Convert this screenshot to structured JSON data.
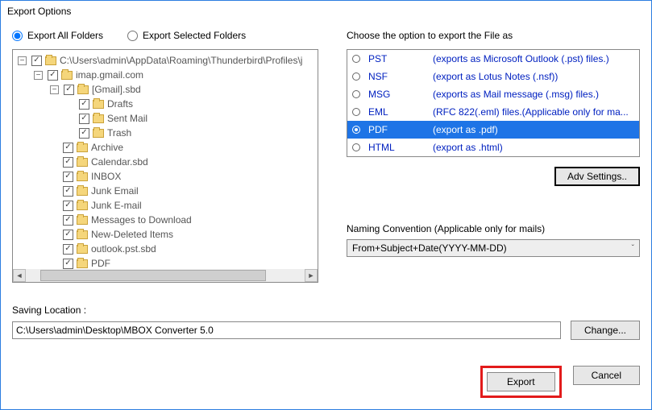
{
  "window": {
    "title": "Export Options"
  },
  "radios": {
    "all": "Export All Folders",
    "selected": "Export Selected Folders",
    "choice": "all"
  },
  "tree": {
    "root": "C:\\Users\\admin\\AppData\\Roaming\\Thunderbird\\Profiles\\j",
    "account": "imap.gmail.com",
    "gmail_sbd": "[Gmail].sbd",
    "items_gmail": [
      "Drafts",
      "Sent Mail",
      "Trash"
    ],
    "items_acct": [
      "Archive",
      "Calendar.sbd",
      "INBOX",
      "Junk Email",
      "Junk E-mail",
      "Messages to Download",
      "New-Deleted Items",
      "outlook.pst.sbd",
      "PDF"
    ]
  },
  "right": {
    "heading": "Choose the option to export the File as",
    "formats": [
      {
        "code": "PST",
        "desc": "(exports as Microsoft Outlook (.pst) files.)"
      },
      {
        "code": "NSF",
        "desc": "(export as Lotus Notes (.nsf))"
      },
      {
        "code": "MSG",
        "desc": "(exports as Mail message (.msg) files.)"
      },
      {
        "code": "EML",
        "desc": "(RFC 822(.eml) files.(Applicable only for ma..."
      },
      {
        "code": "PDF",
        "desc": "(export as .pdf)"
      },
      {
        "code": "HTML",
        "desc": "(export as .html)"
      }
    ],
    "selected": "PDF",
    "adv": "Adv Settings..",
    "naming_label": "Naming Convention (Applicable only for mails)",
    "naming_value": "From+Subject+Date(YYYY-MM-DD)"
  },
  "bottom": {
    "loc_label": "Saving Location :",
    "loc_value": "C:\\Users\\admin\\Desktop\\MBOX Converter 5.0",
    "change": "Change...",
    "export": "Export",
    "cancel": "Cancel"
  }
}
